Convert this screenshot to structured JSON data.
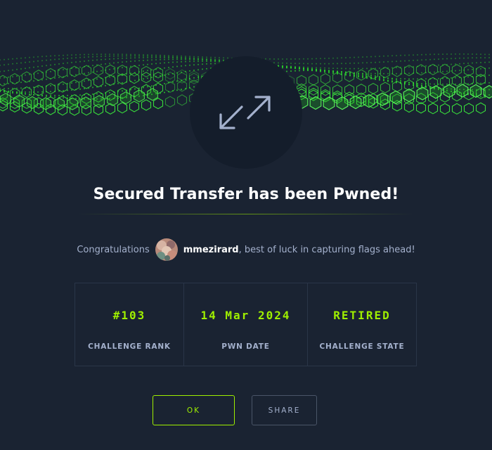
{
  "modal": {
    "icon": "expand-arrows-icon",
    "title": "Secured Transfer has been Pwned!",
    "congrats_prefix": "Congratulations",
    "username": "mmezirard",
    "congrats_suffix": ", best of luck in capturing flags ahead!",
    "avatar": "user-avatar"
  },
  "stats": [
    {
      "value": "#103",
      "label": "CHALLENGE RANK"
    },
    {
      "value": "14 Mar 2024",
      "label": "PWN DATE"
    },
    {
      "value": "RETIRED",
      "label": "CHALLENGE STATE"
    }
  ],
  "buttons": {
    "ok": "OK",
    "share": "SHARE"
  },
  "colors": {
    "accent": "#9fef00",
    "background": "#1a2332",
    "circle": "#141d2b",
    "muted": "#a4b1cd"
  }
}
